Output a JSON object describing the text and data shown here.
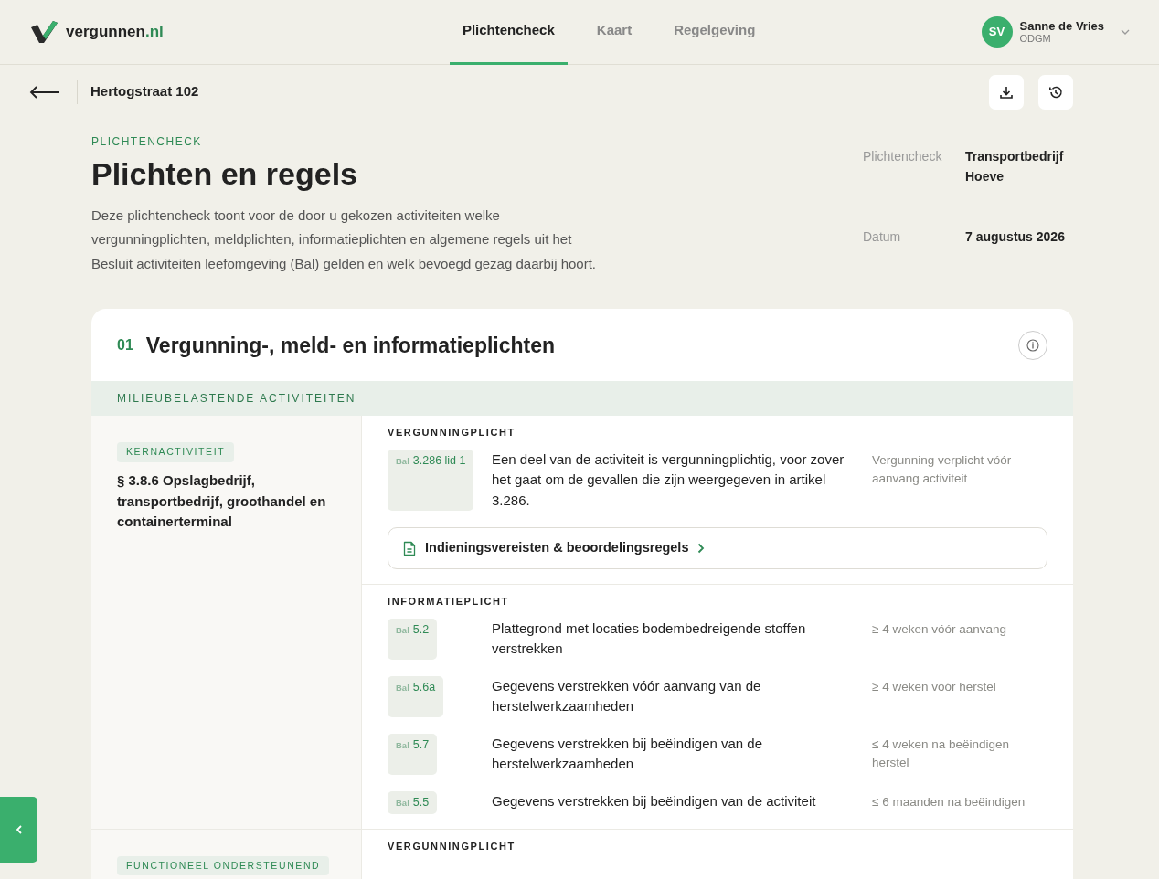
{
  "header": {
    "logo": {
      "name": "vergunnen",
      "suffix": ".nl"
    },
    "tabs": [
      {
        "label": "Plichtencheck",
        "selected": true
      },
      {
        "label": "Kaart",
        "selected": false
      },
      {
        "label": "Regelgeving",
        "selected": false
      }
    ],
    "user": {
      "initials": "SV",
      "name": "Sanne de Vries",
      "org": "ODGM"
    }
  },
  "subbar": {
    "title": "Hertogstraat 102"
  },
  "intro": {
    "eyebrow": "PLICHTENCHECK",
    "title": "Plichten en regels",
    "description": "Deze plichtencheck toont voor de door u gekozen activiteiten welke vergunningplichten, meldplichten, informatieplichten en algemene regels uit het Besluit activiteiten leefomgeving (Bal) gelden en welk bevoegd gezag daarbij hoort."
  },
  "meta": [
    {
      "label": "Plichtencheck",
      "value": "Transportbedrijf Hoeve"
    },
    {
      "label": "Datum",
      "value": "7 augustus 2026"
    }
  ],
  "section": {
    "number": "01",
    "title": "Vergunning-, meld- en informatieplichten",
    "group": "MILIEUBELASTENDE ACTIVITEITEN",
    "activities": [
      {
        "tag": "KERNACTIVITEIT",
        "title": "§ 3.8.6 Opslagbedrijf, transportbedrijf, groothandel en containerterminal",
        "duties": [
          {
            "heading": "VERGUNNINGPLICHT",
            "items": [
              {
                "law": "Bal",
                "article": "3.286 lid 1",
                "text": "Een deel van de activiteit is vergunningplichtig, voor zover het gaat om de gevallen die zijn weergegeven in artikel 3.286.",
                "term": "Vergunning verplicht vóór aanvang activiteit"
              }
            ],
            "link": "Indieningsvereisten & beoordelingsregels"
          },
          {
            "heading": "INFORMATIEPLICHT",
            "items": [
              {
                "law": "Bal",
                "article": "5.2",
                "text": "Plattegrond met locaties bodembedreigende stoffen verstrekken",
                "term": "≥ 4 weken vóór aanvang"
              },
              {
                "law": "Bal",
                "article": "5.6a",
                "text": "Gegevens verstrekken vóór aanvang van de herstelwerkzaamheden",
                "term": "≥ 4 weken vóór herstel"
              },
              {
                "law": "Bal",
                "article": "5.7",
                "text": "Gegevens verstrekken bij beëindigen van de herstelwerkzaamheden",
                "term": "≤ 4 weken na beëindigen herstel"
              },
              {
                "law": "Bal",
                "article": "5.5",
                "text": "Gegevens verstrekken bij beëindigen van de activiteit",
                "term": "≤ 6 maanden na beëindigen"
              }
            ]
          }
        ]
      },
      {
        "tag": "FUNCTIONEEL ONDERSTEUNEND",
        "duties": [
          {
            "heading": "VERGUNNINGPLICHT"
          }
        ]
      }
    ]
  }
}
